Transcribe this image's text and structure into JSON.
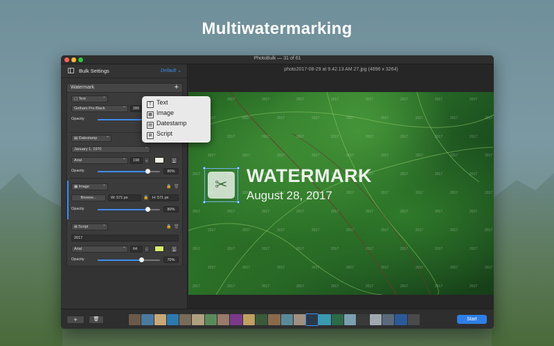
{
  "headline": "Multiwatermarking",
  "window": {
    "title": "PhotoBulk — 31 of 61"
  },
  "sidebar": {
    "title": "Bulk Settings",
    "preset": "Default",
    "panel_title": "Watermark",
    "text_group": {
      "type": "Text",
      "font": "Gotham Pro Black",
      "size": "288",
      "opacity_label": "Opacity"
    },
    "date_group": {
      "type": "Datestamp",
      "date_format": "January 1, 1970",
      "font": "Arial",
      "size": "198",
      "opacity_label": "Opacity",
      "opacity_value": "80%",
      "opacity": 0.8,
      "swatch_color": "#f2f2e6"
    },
    "image_group": {
      "type": "Image",
      "browse_label": "Browse...",
      "width_label": "W:",
      "width_value": "571 px",
      "height_label": "H:",
      "height_value": "571 px",
      "opacity_label": "Opacity",
      "opacity_value": "80%",
      "opacity": 0.8
    },
    "script_group": {
      "type": "Script",
      "script_text": "2017",
      "font": "Arial",
      "size": "64",
      "opacity_label": "Opacity",
      "opacity_value": "70%",
      "opacity": 0.7,
      "swatch_color": "#d9f06a"
    },
    "underline_label": "U"
  },
  "popup_menu": {
    "items": [
      {
        "label": "Text",
        "icon": "text-icon",
        "glyph": "T"
      },
      {
        "label": "Image",
        "icon": "image-icon",
        "glyph": "▦"
      },
      {
        "label": "Datestamp",
        "icon": "calendar-icon",
        "glyph": "▤"
      },
      {
        "label": "Script",
        "icon": "script-icon",
        "glyph": "⊞"
      }
    ]
  },
  "preview": {
    "file_title": "photo2017-08-29 at 9.42.13 AM 27.jpg (4896 x 3264)",
    "watermark_text": "WATERMARK",
    "watermark_date": "August 28, 2017",
    "repeat_year": "2017"
  },
  "bottombar": {
    "add_label": "+",
    "delete_label": "🗑",
    "start_label": "Start",
    "thumb_colors": [
      "#6b5a4a",
      "#4a7aa0",
      "#c8a878",
      "#2a7ab0",
      "#7a6a58",
      "#b0a080",
      "#5a8a5a",
      "#9a7a6a",
      "#7a3a8a",
      "#c0a060",
      "#3a5a3a",
      "#8a6a4a",
      "#5a8a9a",
      "#a09080",
      "#2a3a4a",
      "#3a9ab0",
      "#2c6a4a",
      "#7aa0b0",
      "#3a3a3a",
      "#a0a8b0",
      "#5a6a7a",
      "#2a5a9a",
      "#4a4a4a"
    ]
  },
  "colors": {
    "accent": "#3d8ef0"
  }
}
